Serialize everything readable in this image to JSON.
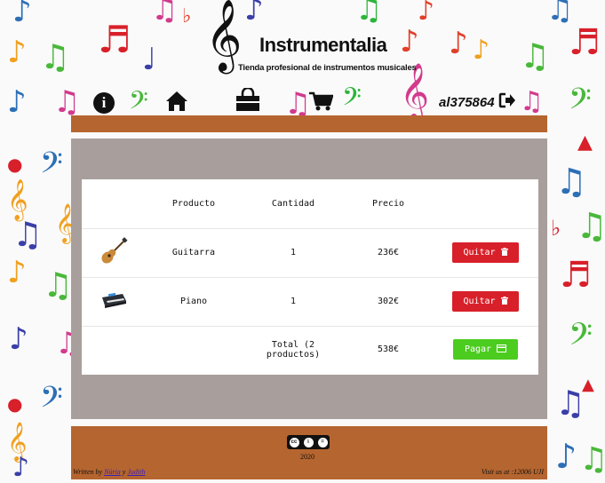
{
  "brand": {
    "name": "Instrumentalia",
    "tagline": "Tienda profesional de instrumentos musicales"
  },
  "nav": {
    "icons": [
      "info-icon",
      "home-icon",
      "shopping-bag-icon",
      "cart-icon"
    ],
    "user": "al375864",
    "logout_icon": "sign-out-icon"
  },
  "cart": {
    "headers": {
      "product": "Producto",
      "quantity": "Cantidad",
      "price": "Precio"
    },
    "items": [
      {
        "icon": "guitar-image",
        "product": "Guitarra",
        "quantity": "1",
        "price": "236€",
        "action": "Quitar",
        "action_icon": "trash-icon"
      },
      {
        "icon": "piano-image",
        "product": "Piano",
        "quantity": "1",
        "price": "302€",
        "action": "Quitar",
        "action_icon": "trash-icon"
      }
    ],
    "total_label": "Total (2 productos)",
    "total_price": "538€",
    "pay_label": "Pagar",
    "pay_icon": "credit-card-icon"
  },
  "footer": {
    "license": "cc-by-sa-badge",
    "year": "2020",
    "written_prefix": "Written by",
    "author1": "Núria",
    "and": "y",
    "author2": "Judith",
    "visit": "Visit us at :12006 UJI"
  },
  "colors": {
    "bar": "#b5652f",
    "panel": "#a89f9d",
    "remove_button": "#d8202a",
    "pay_button": "#4ccc1f"
  }
}
